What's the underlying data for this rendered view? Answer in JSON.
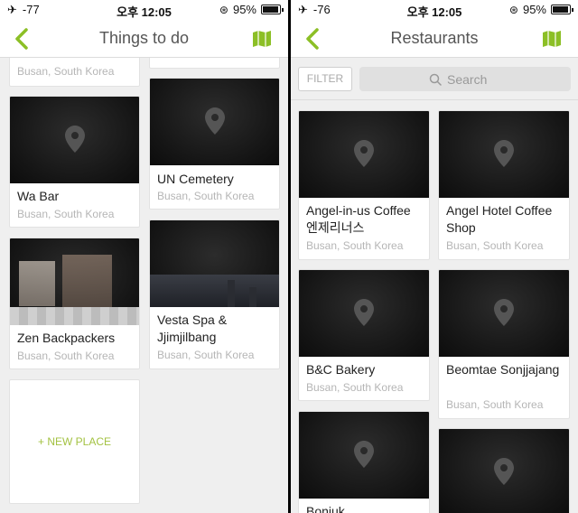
{
  "colors": {
    "accent": "#8cbf26",
    "new_place": "#a3c242"
  },
  "left": {
    "status": {
      "signal": "-77",
      "time": "오후 12:05",
      "battery": "95%",
      "battery_level": 0.95
    },
    "nav": {
      "title": "Things to do",
      "back_icon": "chevron-left-icon",
      "map_icon": "map-icon"
    },
    "cards": [
      {
        "name": "",
        "location": "Busan, South Korea"
      },
      {
        "name": "",
        "location": ""
      },
      {
        "name": "Wa Bar",
        "location": "Busan, South Korea"
      },
      {
        "name": "UN Cemetery",
        "location": "Busan, South Korea"
      },
      {
        "name": "Zen Backpackers",
        "location": "Busan, South Korea"
      },
      {
        "name": "Vesta Spa & Jjimjilbang",
        "location": "Busan, South Korea"
      }
    ],
    "new_place_label": "+ NEW PLACE"
  },
  "right": {
    "status": {
      "signal": "-76",
      "time": "오후 12:05",
      "battery": "95%",
      "battery_level": 0.95
    },
    "nav": {
      "title": "Restaurants",
      "back_icon": "chevron-left-icon",
      "map_icon": "map-icon"
    },
    "filter_label": "FILTER",
    "search_placeholder": "Search",
    "cards": [
      {
        "name": "Angel-in-us Coffee 엔제리너스",
        "location": "Busan, South Korea"
      },
      {
        "name": "Angel Hotel Coffee Shop",
        "location": "Busan, South Korea"
      },
      {
        "name": "B&C Bakery",
        "location": "Busan, South Korea"
      },
      {
        "name": "Beomtae Sonjjajang",
        "location": "Busan, South Korea"
      },
      {
        "name": "Bonjuk",
        "location": ""
      },
      {
        "name": "",
        "location": ""
      }
    ]
  }
}
